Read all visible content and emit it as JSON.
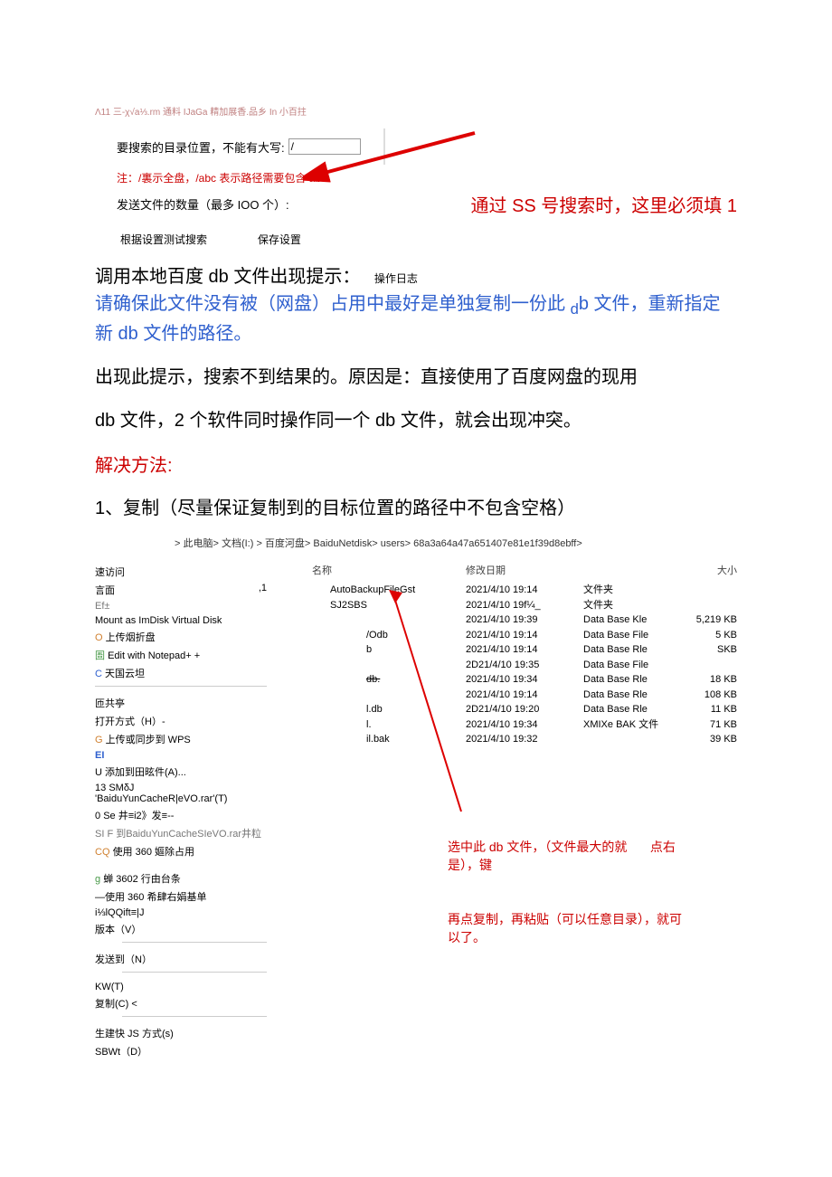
{
  "header_note": "Λ11 三-χ√a⅓.rm 通料 IJaGa 精加展香.品乡 In 小百拄",
  "form": {
    "path_label": "要搜索的目录位置，不能有大写:",
    "path_value": "/",
    "path_note": "注：/裏示全盘，/abc 表示路径需要包含 abc",
    "count_label": "发送文件的数量（最多 IOO 个）:",
    "ss_note": "通过 SS 号搜索时，这里必须填 1",
    "btn_test": "根据设置测试搜索",
    "btn_save": "保存设置",
    "log_btn": "操作日志"
  },
  "para1_a": "调用本地百度 db 文件出现提示：",
  "para1_b": "请确保此文件没有被（网盘）占用中最好是单独复制一份此 ",
  "para1_b2": "b 文件，重新指定新 db 文件的路径。",
  "para1_sub": "d",
  "para2": "出现此提示，搜索不到结果的。原因是：直接使用了百度网盘的现用",
  "para3": "db 文件，2 个软件同时操作同一个 db 文件，就会出现冲突。",
  "solution_heading": "解决方法:",
  "step1": "1、复制（尽量保证复制到的目标位置的路径中不包含空格）",
  "breadcrumb": "> 此电脑> 文档(I:) > 百度河盘> BaiduNetdisk> users> 68a3a64a47a651407e81e1f39d8ebff>",
  "ctx": {
    "quick": "速访问",
    "surf": "言面",
    "eft": "Ef±",
    "mount": "Mount as ImDisk Virtual Disk",
    "upload_fold": "上传烟折盘",
    "edit_np": "Edit with Notepad+ +",
    "cloud": "天国云坦",
    "share": "匝共亭",
    "open_h": "打开方式（H）-",
    "wps": "上传或同步到 WPS",
    "ei": "EI",
    "attach": "添加到田昡件(A)...",
    "rar1": "SMδJ 'BaiduYunCacheR|eVO.rar'(T)",
    "rar2": "Se 井≡i2》发≡--",
    "rar3": "SI F 到BaiduYunCacheSIeVO.rar井粒",
    "cq360": "使用 360 嫗除占用",
    "g3602": "蝉 3602 行由台条",
    "use360": "—使用 360 希肆右娟基单",
    "qqift": "i⅓lQQift≡|J",
    "version": "版本（V）",
    "sendto": "发送到（N）",
    "kwt": "KW(T)",
    "copy": "复制(C) <",
    "jsquick": "生建快 JS 方式(s)",
    "sbwt": "SBWt（D）",
    "dot1": ",1",
    "u13": "13",
    "u0": "0",
    "uU": "U",
    "uG": "G",
    "uC": "C",
    "uO": "O",
    "uBox": "圄",
    "uCQ": "CQ",
    "ug": "g"
  },
  "cols": {
    "name": "名称",
    "date": "修改日期",
    "size": "大小"
  },
  "files": [
    {
      "name": "AutoBackupFileGst",
      "date": "2021/4/10   19:14",
      "type": "文件夹",
      "size": ""
    },
    {
      "name": "SJ2SBS",
      "date": "2021/4/10   19f¼_",
      "type": "文件夹",
      "size": ""
    },
    {
      "name": "",
      "date": "2021/4/10   19:39",
      "type": "Data   Base   Kle",
      "size": "5,219 KB"
    },
    {
      "name": "/Odb",
      "date": "2021/4/10   19:14",
      "type": "Data   Base   File",
      "size": "5 KB"
    },
    {
      "name": "b",
      "date": "2021/4/10   19:14",
      "type": "Data   Base   Rle",
      "size": "SKB"
    },
    {
      "name": "",
      "date": "2D21/4/10   19:35",
      "type": "Data   Base   File",
      "size": ""
    },
    {
      "name": "db.",
      "date": "2021/4/10   19:34",
      "type": "Data   Base   Rle",
      "size": "18 KB"
    },
    {
      "name": "",
      "date": "2021/4/10   19:14",
      "type": "Data   Base   Rle",
      "size": "108 KB"
    },
    {
      "name": "l.db",
      "date": "2D21/4/10   19:20",
      "type": "Data   Base   Rle",
      "size": "11 KB"
    },
    {
      "name": "l.",
      "date": "2021/4/10   19:34",
      "type": "XMIXe BAK 文件",
      "size": "71 KB"
    },
    {
      "name": "il.bak",
      "date": "2021/4/10 19:32",
      "type": "",
      "size": "39 KB"
    }
  ],
  "anno1a": "选中此 db 文件，（文件最大的就是），键",
  "anno1b": "点右",
  "anno2": "再点复制，再粘贴（可以任意目录），就可以了。"
}
